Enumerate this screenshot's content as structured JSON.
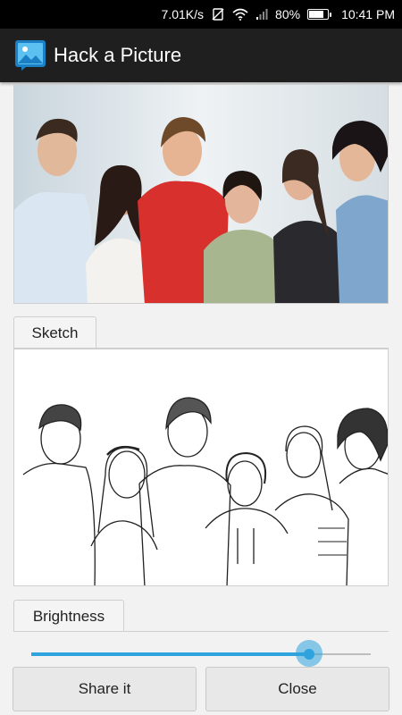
{
  "status_bar": {
    "net_speed": "7.01K/s",
    "battery_text": "80%",
    "battery_level": 0.8,
    "time": "10:41 PM",
    "icons": [
      "no-sim-icon",
      "wifi-icon",
      "signal-icon",
      "battery-icon"
    ]
  },
  "app_bar": {
    "title": "Hack a Picture",
    "logo_icon": "picture-icon"
  },
  "photo": {
    "description_icon": "original-photo-image"
  },
  "sketch_section": {
    "tab_label": "Sketch"
  },
  "brightness_section": {
    "tab_label": "Brightness",
    "value": 0.82
  },
  "buttons": {
    "share_label": "Share it",
    "close_label": "Close"
  },
  "colors": {
    "accent": "#2ea3de",
    "app_bar": "#1f1f1f",
    "background": "#f2f2f2"
  }
}
